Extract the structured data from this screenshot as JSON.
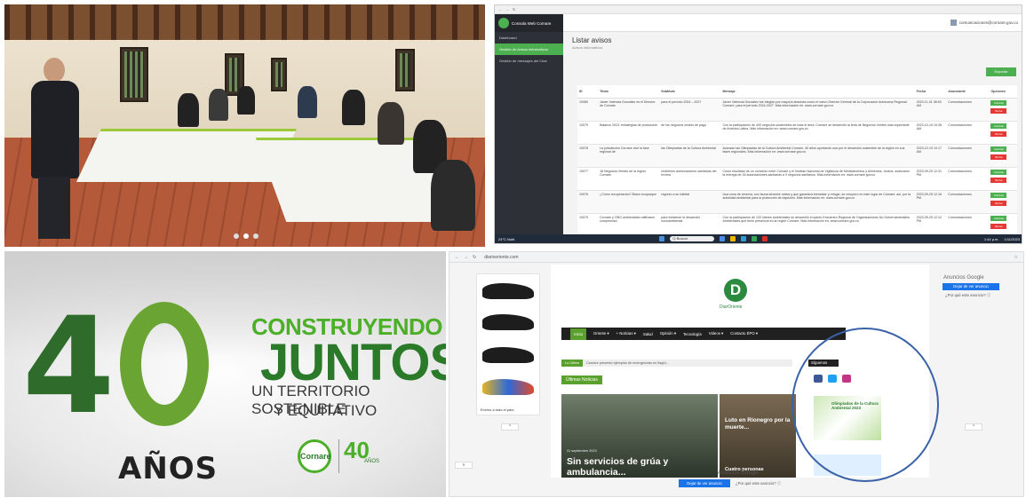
{
  "slider": {
    "dot_count": 3,
    "active_index": 1
  },
  "admin": {
    "brand": "Consola Web Cornare",
    "sidebar": [
      "Dashboard",
      "Gestión de Avisos Informativos",
      "Gestión de mensajes del Chat"
    ],
    "user_email": "comunicaciones@cornare.gov.co",
    "page_title": "Listar avisos",
    "page_sub": "Avisos informativos",
    "export_label": "Exportar",
    "columns": [
      "ID",
      "Título",
      "Subtítulo",
      "Mensaje",
      "Fecha",
      "Anunciante",
      "Opciones"
    ],
    "rows": [
      {
        "id": "10080",
        "titulo": "Javier Valencia González es el Director de Cornare",
        "subtitulo": "para el período 2024 – 2027",
        "mensaje": "Javier Valencia González fue elegido por mayoría absoluta como el nuevo Director General de la Corporación Autónoma Regional. Cornare, para el período 2024-2027. Más información en: www.cornare.gov.co",
        "fecha": "2023-11-01 08:53 AM",
        "anunciante": "Comunicaciones"
      },
      {
        "id": "10079",
        "titulo": "Balance 2023: estrategias de producción",
        "subtitulo": "de los negocios verdes de pago",
        "mensaje": "Con la participación de 400 negocios sostenibles de toda el área, Cornare se desarrolló la feria de Negocios Verdes más importante de América Latina. Más información en: www.cornare.gov.co",
        "fecha": "2023-10-19 10:26 AM",
        "anunciante": "Comunicaciones"
      },
      {
        "id": "10078",
        "titulo": "La jurisdicción Cornare vive la fase regional de",
        "subtitulo": "las Olimpiadas de la Cultura Ambiental",
        "mensaje": "Avanzan las Olimpiadas de la Cultura Ambiental Cornare, 40 años aportando una por el desarrollo sostenible de la región en sus fases regionales. Más información en: www.cornare.gov.co",
        "fecha": "2023-10-19 10:17 AM",
        "anunciante": "Comunicaciones"
      },
      {
        "id": "10077",
        "titulo": "18 Negocios Verdes de la región Cornare",
        "subtitulo": "recibieron autorizaciones sanitarias del Invima",
        "mensaje": "Como resultado de un convenio entre Cornare y el Instituto Nacional de Vigilancia de Medicamentos y Alimentos -Invima, avanzaron la entrega de 18 autorizaciones sanitarias a 9 negocios sanitarios. Más información en: www.cornare.gov.co",
        "fecha": "2023-09-25 12:31 PM",
        "anunciante": "Comunicaciones"
      },
      {
        "id": "10076",
        "titulo": "¿Cómo recuperación? Bravo ecoparque",
        "subtitulo": "regresó a su hábitat",
        "mensaje": "Una zona de reserva, con fauna silvestre nativa y que garantiza bienestar y refugio, se recuperó en este lugar de Cornare; así, por la autoridad ambiental para la protección de especies. Más información en: www.cornare.gov.co",
        "fecha": "2023-09-25 12:16 PM",
        "anunciante": "Comunicaciones"
      },
      {
        "id": "10075",
        "titulo": "Cornare y ONG ambientales ratificaron compromiso",
        "subtitulo": "para fortalecer el desarrollo socioambiental",
        "mensaje": "Con la participación de 120 líderes ambientales se desarrolló el quinto Encuentro Regional de Organizaciones No Gubernamentales Ambientales que tiene presencia en la región Cornare. Más información en: www.cornare.gov.co",
        "fecha": "2023-09-25 12:12 PM",
        "anunciante": "Comunicaciones"
      }
    ],
    "btn_edit": "Cambiar",
    "btn_delete": "Borrar",
    "taskbar": {
      "weather": "24°C Nubl.",
      "search": "Q Buscar",
      "time": "1:44 p.m.",
      "date": "1/11/2023"
    }
  },
  "poster": {
    "forty": "40",
    "anos": "AÑOS",
    "line1": "CONSTRUYENDO",
    "line2": "JUNTOS",
    "line3": "UN TERRITORIO SOSTENIBLE",
    "line4": "Y EQUITATIVO",
    "logo_cornare": "Cornare",
    "logo_forty": "40",
    "logo_forty_sub": "AÑOS"
  },
  "news": {
    "url": "diariooriente.com",
    "shoe_ad_text": "Envíos a todo el país",
    "site_name": "DiarOriente",
    "logo_letter": "D",
    "nav": [
      "Inicio",
      "Oriente ▾",
      "+ Noticias ▾",
      "Salud",
      "Opinión ▾",
      "Tecnología",
      "Videos ▾",
      "Contacto ÉPO ▾"
    ],
    "ticker_label": "Lo Último",
    "ticker_text": "Cornare presentó ejemplos de emergencias en Itagüí...",
    "ultimas": "Últimas Noticias",
    "big_date": "31 septiembre 2023",
    "big_headline": "Sin servicios de grúa y ambulancia...",
    "small_headline": "Luto en Rionegro por la muerte...",
    "small_headline2": "Cuatro personas",
    "siguenos": "Síguenos",
    "promo_title": "Olimpiadas de la Cultura Ambiental 2023",
    "google_ad": "Anuncios Google",
    "stop_ad": "Dejar de ver anuncio",
    "why_ad": "¿Por qué este anuncio? ⓘ"
  }
}
